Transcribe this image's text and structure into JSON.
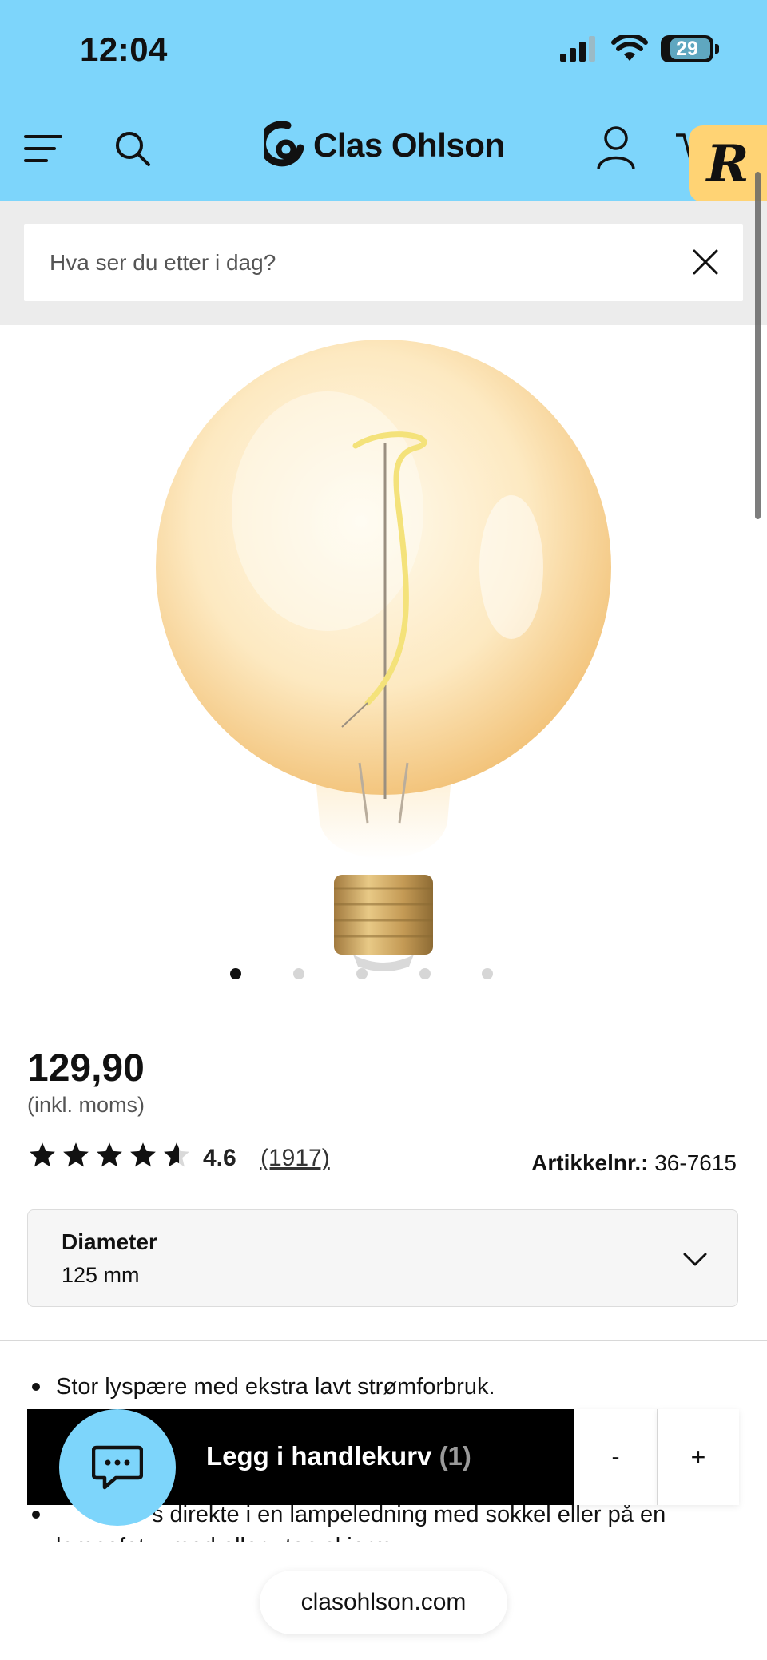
{
  "status_bar": {
    "time": "12:04",
    "battery": "29"
  },
  "header": {
    "brand": "Clas Ohlson",
    "accent_color": "#7dd5fb",
    "icons": [
      "menu-icon",
      "search-icon",
      "user-icon",
      "cart-icon"
    ]
  },
  "search": {
    "placeholder": "Hva ser du etter i dag?"
  },
  "gallery": {
    "image": "vintage globe filament light bulb",
    "dots_total": 5,
    "active_index": 0
  },
  "product": {
    "price": "129,90",
    "price_note": "(inkl. moms)",
    "rating": {
      "stars": 4.6,
      "value": "4.6",
      "count": "(1917)"
    },
    "article_label": "Artikkelnr.:",
    "article_number": "36-7615"
  },
  "variant": {
    "label": "Diameter",
    "value": "125 mm"
  },
  "description": {
    "bullets": [
      "Stor lyspære med ekstra lavt strømforbruk.",
      "Henges direkte i en lampeledning med sokkel eller på en lampefot – med eller uten skjerm."
    ],
    "bullet2_visible": "s direkte i en lampeledning med sokkel eller på en",
    "bullet2_line2": "lampefot – med eller uten skjerm."
  },
  "cart_bar": {
    "label": "Legg i handlekurv",
    "count": "(1)",
    "minus": "-",
    "plus": "+"
  },
  "browser": {
    "url": "clasohlson.com"
  }
}
